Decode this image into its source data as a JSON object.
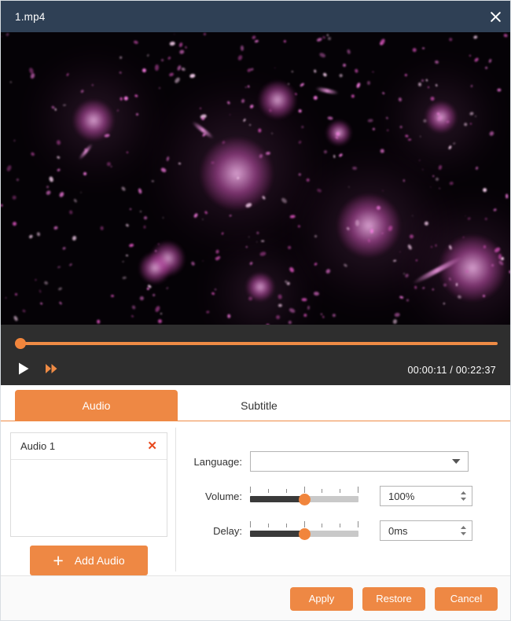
{
  "window": {
    "title": "1.mp4",
    "close_icon": "close-icon"
  },
  "player": {
    "play_icon": "play-icon",
    "fast_forward_icon": "fast-forward-icon",
    "current_time": "00:00:11",
    "total_time": "00:22:37",
    "time_display": "00:00:11 / 00:22:37",
    "progress_percent": 0,
    "accent_color": "#f1853c"
  },
  "tabs": [
    {
      "label": "Audio",
      "active": true
    },
    {
      "label": "Subtitle",
      "active": false
    }
  ],
  "audio_list": {
    "items": [
      {
        "label": "Audio 1",
        "remove_icon": "close-icon"
      }
    ],
    "add_button": {
      "label": "Add Audio",
      "icon": "plus-icon"
    }
  },
  "form": {
    "language": {
      "label": "Language:",
      "value": "",
      "placeholder": "",
      "chevron_icon": "chevron-down-icon"
    },
    "volume": {
      "label": "Volume:",
      "value": "100%",
      "slider_percent": 50,
      "spinner_icon": "spinner-arrows-icon"
    },
    "delay": {
      "label": "Delay:",
      "value": "0ms",
      "slider_percent": 50,
      "spinner_icon": "spinner-arrows-icon"
    }
  },
  "footer": {
    "apply_label": "Apply",
    "restore_label": "Restore",
    "cancel_label": "Cancel"
  },
  "theme": {
    "accent": "#ee8844",
    "titlebar": "#2f4055",
    "player_bg": "#2e2e2e",
    "danger": "#e8491d"
  }
}
